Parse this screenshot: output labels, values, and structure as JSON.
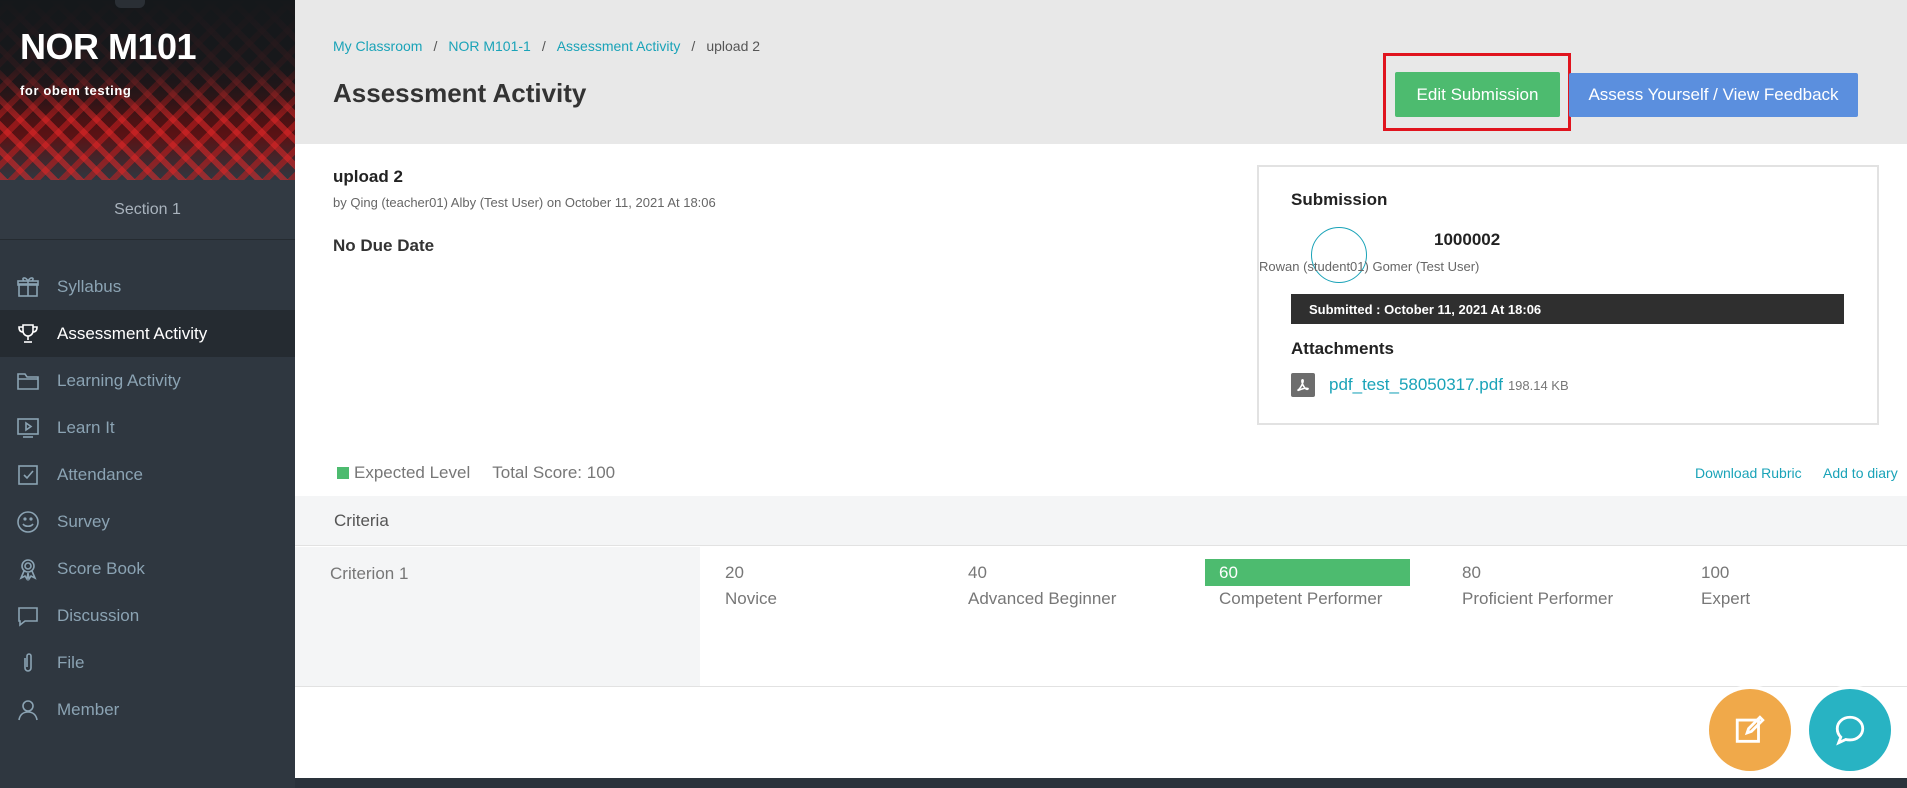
{
  "sidebar": {
    "course_title": "NOR M101",
    "course_subtitle": "for obem testing",
    "section": "Section 1",
    "items": [
      {
        "label": "Syllabus",
        "icon": "gift-icon"
      },
      {
        "label": "Assessment Activity",
        "icon": "trophy-icon",
        "active": true
      },
      {
        "label": "Learning Activity",
        "icon": "folder-icon"
      },
      {
        "label": "Learn It",
        "icon": "play-screen-icon"
      },
      {
        "label": "Attendance",
        "icon": "checkbox-icon"
      },
      {
        "label": "Survey",
        "icon": "smiley-icon"
      },
      {
        "label": "Score Book",
        "icon": "award-icon"
      },
      {
        "label": "Discussion",
        "icon": "speech-bubble-icon"
      },
      {
        "label": "File",
        "icon": "paperclip-icon"
      },
      {
        "label": "Member",
        "icon": "user-icon"
      }
    ]
  },
  "breadcrumb": {
    "items": [
      "My Classroom",
      "NOR M101-1",
      "Assessment Activity"
    ],
    "current": "upload 2",
    "separator": "/"
  },
  "header": {
    "title": "Assessment Activity",
    "edit_label": "Edit Submission",
    "assess_label": "Assess Yourself / View Feedback"
  },
  "activity": {
    "name": "upload 2",
    "meta": "by Qing (teacher01) Alby (Test User) on October 11, 2021 At 18:06",
    "due": "No Due Date"
  },
  "submission": {
    "title": "Submission",
    "student_id": "1000002",
    "student_name": "Rowan (student01) Gomer (Test User)",
    "submitted": "Submitted : October 11, 2021 At 18:06",
    "attachments_title": "Attachments",
    "file_name": "pdf_test_58050317.pdf",
    "file_size": "198.14 KB"
  },
  "rubric": {
    "legend": "Expected Level",
    "total_score": "Total Score: 100",
    "download": "Download Rubric",
    "add_diary": "Add to diary",
    "criteria_header": "Criteria",
    "criterion": "Criterion 1",
    "levels": [
      {
        "score": "20",
        "label": "Novice"
      },
      {
        "score": "40",
        "label": "Advanced Beginner"
      },
      {
        "score": "60",
        "label": "Competent Performer",
        "expected": true
      },
      {
        "score": "80",
        "label": "Proficient Performer"
      },
      {
        "score": "100",
        "label": "Expert"
      }
    ]
  },
  "colors": {
    "accent": "#1aa3b8",
    "success": "#4dbb6f",
    "primary": "#5b8fde",
    "highlight": "#e0141e",
    "fab_note": "#f0a94a",
    "fab_chat": "#28b3c3"
  }
}
